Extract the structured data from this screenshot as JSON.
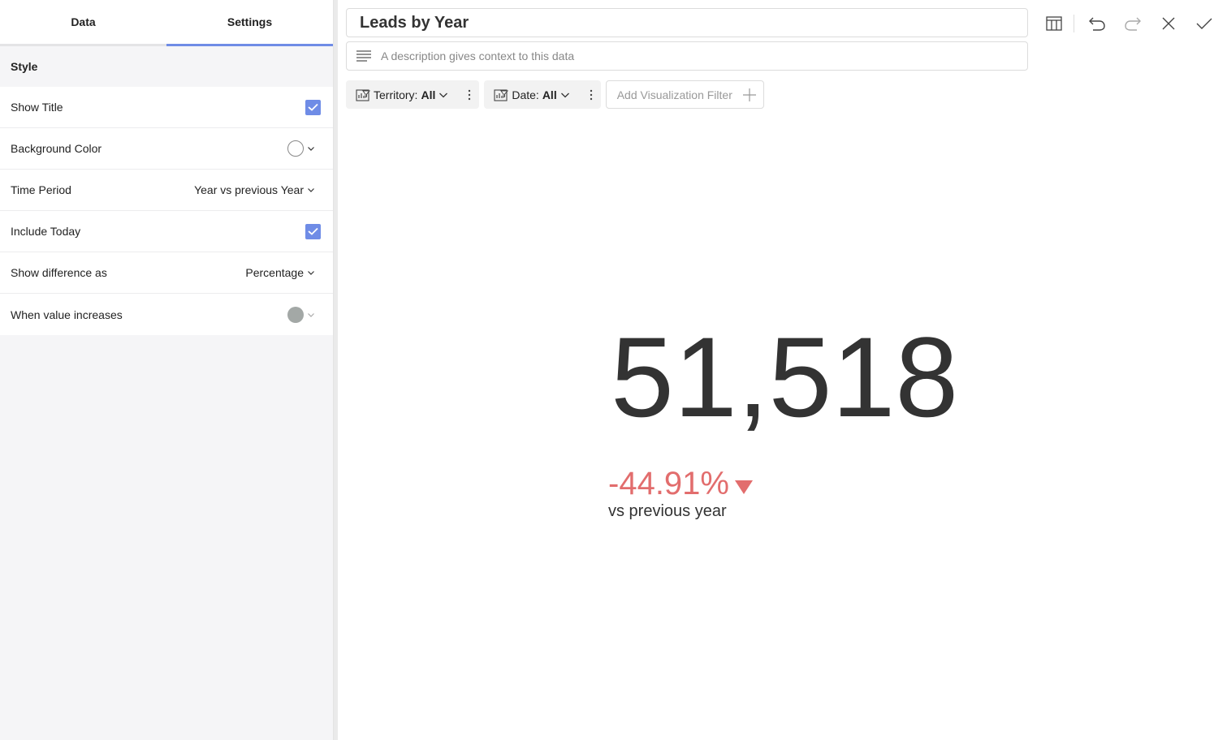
{
  "tabs": [
    {
      "label": "Data",
      "active": false
    },
    {
      "label": "Settings",
      "active": true
    }
  ],
  "settings": {
    "section_title": "Style",
    "rows": {
      "show_title": {
        "label": "Show Title",
        "checked": true
      },
      "background_color": {
        "label": "Background Color",
        "color": "#ffffff"
      },
      "time_period": {
        "label": "Time Period",
        "value": "Year vs previous Year"
      },
      "include_today": {
        "label": "Include Today",
        "checked": true
      },
      "show_difference": {
        "label": "Show difference as",
        "value": "Percentage"
      },
      "value_increases": {
        "label": "When value increases",
        "color": "#a3a8a6"
      }
    }
  },
  "header": {
    "title": "Leads by Year",
    "description_placeholder": "A description gives context to this data"
  },
  "toolbar": {
    "icons": [
      "table-icon",
      "undo-icon",
      "redo-icon",
      "close-icon",
      "check-icon"
    ]
  },
  "filters": [
    {
      "label": "Territory:",
      "value": "All"
    },
    {
      "label": "Date:",
      "value": "All"
    }
  ],
  "add_filter_label": "Add Visualization Filter",
  "kpi": {
    "value": "51,518",
    "difference": "-44.91%",
    "difference_direction": "down",
    "difference_color": "#e26d6d",
    "comparison_label": "vs previous year"
  },
  "colors": {
    "accent": "#6f8ce6",
    "negative": "#e26d6d"
  }
}
